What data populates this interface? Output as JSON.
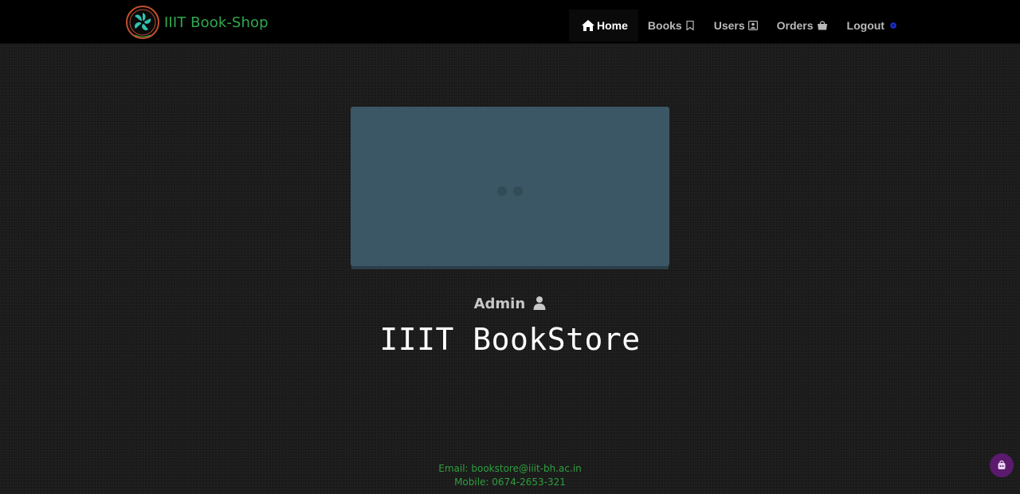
{
  "brand": {
    "name": "IIIT Book-Shop",
    "color": "#2fa84f"
  },
  "nav": {
    "items": [
      {
        "label": "Home",
        "icon": "home-icon",
        "active": true
      },
      {
        "label": "Books",
        "icon": "bookmark-icon"
      },
      {
        "label": "Users",
        "icon": "user-badge-icon"
      },
      {
        "label": "Orders",
        "icon": "shopping-bag-icon"
      },
      {
        "label": "Logout",
        "icon": "power-icon"
      }
    ]
  },
  "hero": {
    "slide_count": 2,
    "active_slide": 0,
    "background_color": "#3b5766"
  },
  "role": {
    "label": "Admin",
    "icon": "user-icon"
  },
  "title": "IIIT BookStore",
  "footer": {
    "email": "Email: bookstore@iiit-bh.ac.in",
    "mobile": "Mobile: 0674-2653-321",
    "color": "#2e9e3e"
  },
  "chat": {
    "icon": "chat-bot-icon",
    "color": "#5b1a6e"
  }
}
